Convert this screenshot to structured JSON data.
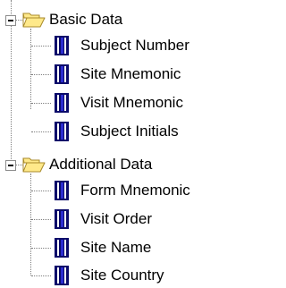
{
  "tree": {
    "groups": [
      {
        "label": "Basic Data",
        "icon": "open-folder-icon",
        "expanded": true,
        "items": [
          {
            "label": "Subject Number",
            "icon": "data-field-icon"
          },
          {
            "label": "Site Mnemonic",
            "icon": "data-field-icon"
          },
          {
            "label": "Visit Mnemonic",
            "icon": "data-field-icon"
          },
          {
            "label": "Subject Initials",
            "icon": "data-field-icon"
          }
        ]
      },
      {
        "label": "Additional Data",
        "icon": "open-folder-icon",
        "expanded": true,
        "items": [
          {
            "label": "Form Mnemonic",
            "icon": "data-field-icon"
          },
          {
            "label": "Visit Order",
            "icon": "data-field-icon"
          },
          {
            "label": "Site Name",
            "icon": "data-field-icon"
          },
          {
            "label": "Site Country",
            "icon": "data-field-icon"
          }
        ]
      }
    ]
  },
  "colors": {
    "folder_fill": "#ffe98a",
    "folder_stroke": "#a88a2a",
    "field_dark": "#0a0a6a",
    "field_light": "#ffffff",
    "field_accent": "#2c2cd0",
    "tree_lines": "#7f7f7f"
  }
}
